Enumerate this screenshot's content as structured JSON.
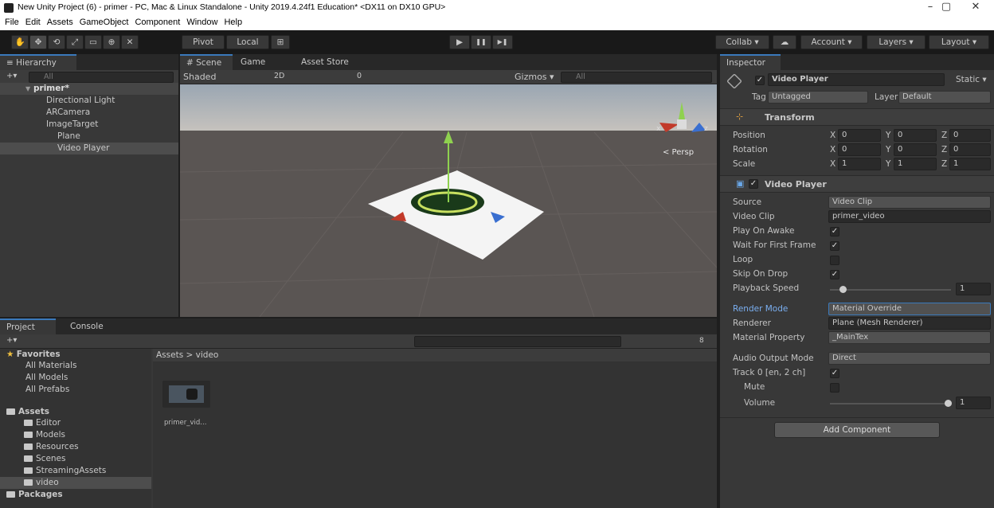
{
  "window": {
    "title": "New Unity Project (6) - primer - PC, Mac & Linux Standalone - Unity 2019.4.24f1 Education* <DX11 on DX10 GPU>",
    "minimize": "–",
    "maximize": "▢",
    "close": "✕"
  },
  "menu": [
    "File",
    "Edit",
    "Assets",
    "GameObject",
    "Component",
    "Window",
    "Help"
  ],
  "toolbar": {
    "tools": [
      "✋",
      "✥",
      "⟲",
      "⤢",
      "▭",
      "⊕",
      "✕"
    ],
    "pivot": "Pivot",
    "local": "Local",
    "grid": "⊞",
    "play": "▶",
    "pause": "❚❚",
    "step": "▶❚",
    "collab": "Collab ▾",
    "cloud": "☁",
    "account": "Account ▾",
    "layers": "Layers ▾",
    "layout": "Layout ▾"
  },
  "hierarchy": {
    "tab": "≡ Hierarchy",
    "add": "+▾",
    "search_placeholder": "All",
    "scene": "primer*",
    "items": [
      "Directional Light",
      "ARCamera",
      "ImageTarget",
      "Plane",
      "Video Player"
    ]
  },
  "scene": {
    "tabs": [
      "# Scene",
      "Game",
      "Asset Store"
    ],
    "shading": "Shaded",
    "mode2d": "2D",
    "gizmos": "Gizmos ▾",
    "search_placeholder": "All",
    "fx_count": "0",
    "persp": "< Persp",
    "axis_x": "x",
    "axis_z": "z"
  },
  "project": {
    "tabs": [
      "Project",
      "Console"
    ],
    "add": "+▾",
    "hidden_count": "8",
    "favorites_label": "Favorites",
    "favorites": [
      "All Materials",
      "All Models",
      "All Prefabs"
    ],
    "assets_label": "Assets",
    "folders": [
      "Editor",
      "Models",
      "Resources",
      "Scenes",
      "StreamingAssets",
      "video"
    ],
    "packages_label": "Packages",
    "breadcrumb": "Assets > video",
    "asset_name": "primer_vid..."
  },
  "inspector": {
    "tab": "Inspector",
    "object_name": "Video Player",
    "static_label": "Static ▾",
    "tag_label": "Tag",
    "tag_value": "Untagged",
    "layer_label": "Layer",
    "layer_value": "Default",
    "transform": {
      "title": "Transform",
      "position_label": "Position",
      "rotation_label": "Rotation",
      "scale_label": "Scale",
      "position": [
        "0",
        "0",
        "0"
      ],
      "rotation": [
        "0",
        "0",
        "0"
      ],
      "scale": [
        "1",
        "1",
        "1"
      ]
    },
    "video_player": {
      "title": "Video Player",
      "source_label": "Source",
      "source": "Video Clip",
      "clip_label": "Video Clip",
      "clip": "primer_video",
      "play_on_awake_label": "Play On Awake",
      "wait_label": "Wait For First Frame",
      "loop_label": "Loop",
      "skip_label": "Skip On Drop",
      "speed_label": "Playback Speed",
      "speed": "1",
      "render_mode_label": "Render Mode",
      "render_mode": "Material Override",
      "renderer_label": "Renderer",
      "renderer": "Plane (Mesh Renderer)",
      "material_prop_label": "Material Property",
      "material_prop": "_MainTex",
      "audio_mode_label": "Audio Output Mode",
      "audio_mode": "Direct",
      "track_label": "Track 0 [en, 2 ch]",
      "mute_label": "Mute",
      "volume_label": "Volume",
      "volume": "1",
      "play_on_awake": true,
      "wait_first_frame": true,
      "loop": false,
      "skip_on_drop": true,
      "track0": true,
      "mute": false,
      "speed_slider_fraction": 0.1,
      "volume_slider_fraction": 1.0
    },
    "add_component": "Add Component"
  },
  "colors": {
    "selection": "#3a79bb",
    "panel": "#383838",
    "accent_green": "#8fd14f"
  }
}
